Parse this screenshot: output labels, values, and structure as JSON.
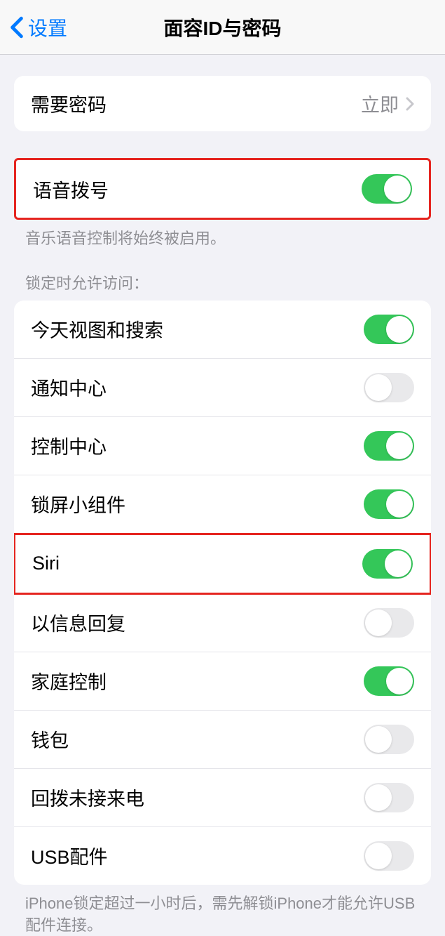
{
  "header": {
    "back_label": "设置",
    "title": "面容ID与密码"
  },
  "require_passcode": {
    "label": "需要密码",
    "value": "立即"
  },
  "voice_dial": {
    "label": "语音拨号",
    "enabled": true,
    "footer": "音乐语音控制将始终被启用。"
  },
  "lock_section": {
    "header": "锁定时允许访问：",
    "items": [
      {
        "label": "今天视图和搜索",
        "enabled": true
      },
      {
        "label": "通知中心",
        "enabled": false
      },
      {
        "label": "控制中心",
        "enabled": true
      },
      {
        "label": "锁屏小组件",
        "enabled": true
      },
      {
        "label": "Siri",
        "enabled": true
      },
      {
        "label": "以信息回复",
        "enabled": false
      },
      {
        "label": "家庭控制",
        "enabled": true
      },
      {
        "label": "钱包",
        "enabled": false
      },
      {
        "label": "回拨未接来电",
        "enabled": false
      },
      {
        "label": "USB配件",
        "enabled": false
      }
    ],
    "footer": "iPhone锁定超过一小时后，需先解锁iPhone才能允许USB配件连接。"
  }
}
